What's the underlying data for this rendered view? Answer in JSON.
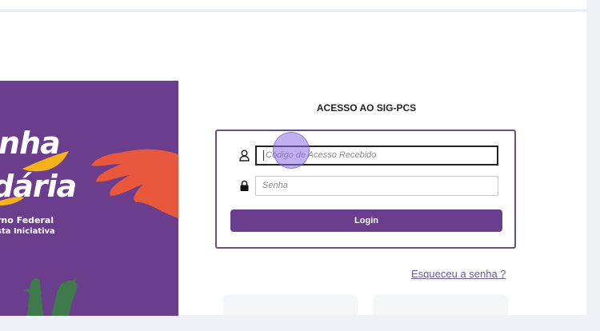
{
  "banner": {
    "line1": "inha",
    "line2": "dária",
    "sub1": "rno Federal",
    "sub2": "sta Iniciativa"
  },
  "form": {
    "title": "ACESSO AO SIG-PCS",
    "code_placeholder": "Código de Acesso Recebido",
    "password_placeholder": "Senha",
    "login_label": "Login",
    "forgot_label": "Esqueceu a senha ?"
  },
  "colors": {
    "brand_purple": "#6a3e8c",
    "accent_orange": "#e8583c",
    "accent_yellow": "#f3b21b",
    "plant_green": "#3f7a4a"
  },
  "icons": {
    "user": "user-icon",
    "lock": "lock-icon"
  }
}
